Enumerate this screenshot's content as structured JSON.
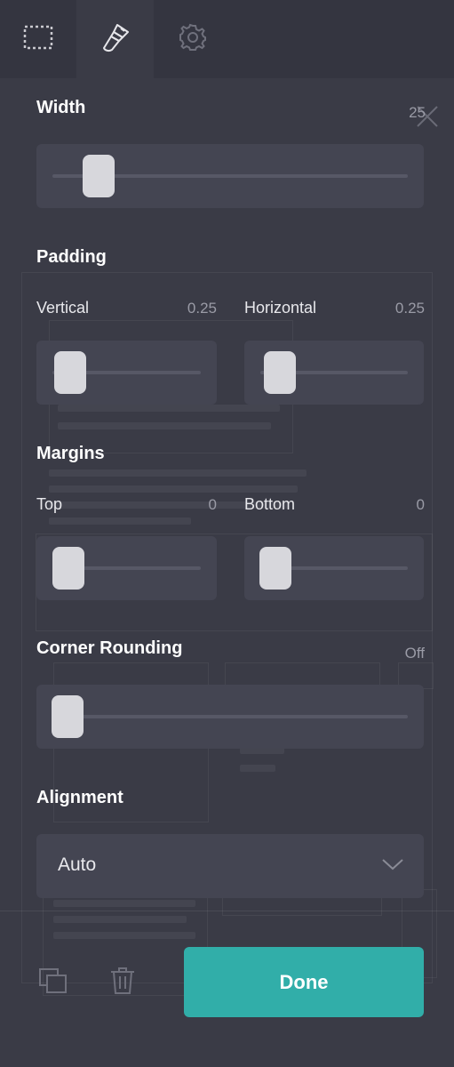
{
  "tabs": [
    {
      "icon": "selection-box-icon"
    },
    {
      "icon": "paintbrush-icon",
      "active": true
    },
    {
      "icon": "gear-icon"
    }
  ],
  "width": {
    "label": "Width",
    "value": "25",
    "level_percent": 12
  },
  "padding": {
    "label": "Padding",
    "vertical": {
      "label": "Vertical",
      "value": "0.25"
    },
    "horizontal": {
      "label": "Horizontal",
      "value": "0.25"
    }
  },
  "margins": {
    "label": "Margins",
    "top": {
      "label": "Top",
      "value": "0"
    },
    "bottom": {
      "label": "Bottom",
      "value": "0"
    }
  },
  "corner_rounding": {
    "label": "Corner Rounding",
    "value": "Off"
  },
  "alignment": {
    "label": "Alignment",
    "selected": "Auto"
  },
  "footer": {
    "done_label": "Done"
  },
  "colors": {
    "accent": "#31aea9",
    "panel": "#3a3b46",
    "control": "#444552",
    "handle": "#d7d7dc"
  }
}
